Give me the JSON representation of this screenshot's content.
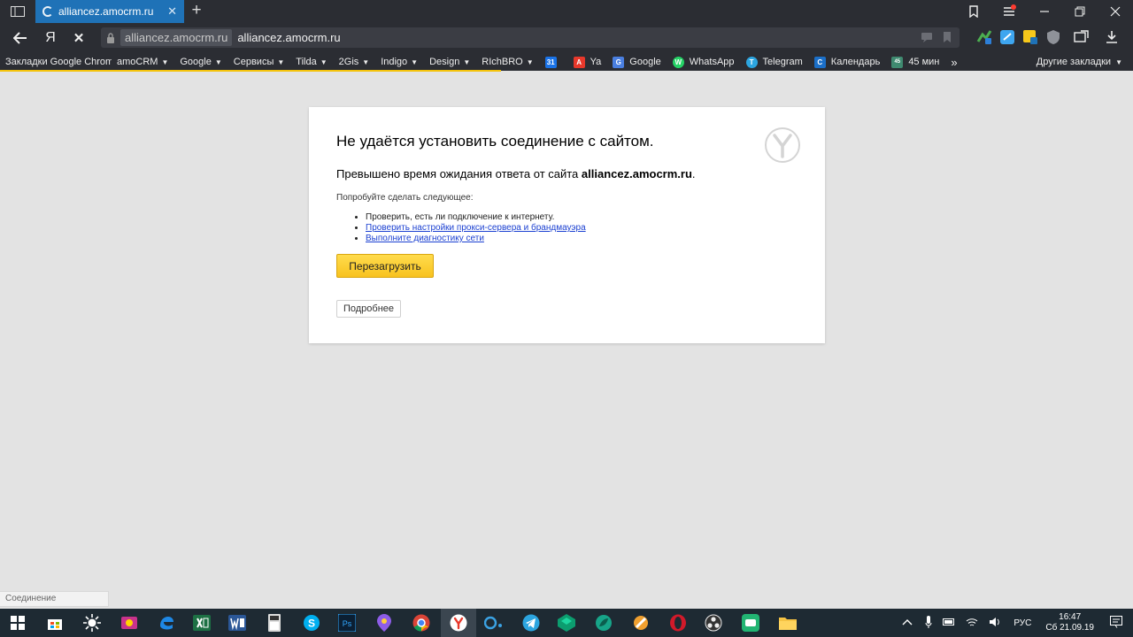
{
  "browser": {
    "tab": {
      "title": "alliancez.amocrm.ru",
      "close": "✕"
    },
    "new_tab": "+",
    "address": {
      "domain": "alliancez.amocrm.ru",
      "url": "alliancez.amocrm.ru"
    },
    "nav": {
      "yandex_logo": "Я",
      "stop": "✕"
    }
  },
  "bookmarks": {
    "folders": [
      {
        "label": "Закладки Google Chrome"
      },
      {
        "label": "amoCRM"
      },
      {
        "label": "Google"
      },
      {
        "label": "Сервисы"
      },
      {
        "label": "Tilda"
      },
      {
        "label": "2Gis"
      },
      {
        "label": "Indigo"
      },
      {
        "label": "Design"
      },
      {
        "label": "RIchBRO"
      }
    ],
    "links": [
      {
        "label": "",
        "icon": "calendar-31-icon",
        "badge": "31",
        "color": "#1a73e8"
      },
      {
        "label": "Ya",
        "icon": "yandex-ya-icon",
        "badge": "A",
        "color": "#e8382b"
      },
      {
        "label": "Google",
        "icon": "google-translate-icon",
        "badge": "G",
        "color": "#4a7fe0"
      },
      {
        "label": "WhatsApp",
        "icon": "whatsapp-icon",
        "badge": "W",
        "color": "#25d366"
      },
      {
        "label": "Telegram",
        "icon": "telegram-icon",
        "badge": "T",
        "color": "#2ca5e0"
      },
      {
        "label": "Календарь",
        "icon": "outlook-calendar-icon",
        "badge": "C",
        "color": "#1b6fc8"
      },
      {
        "label": "45 мин",
        "icon": "timer-45-icon",
        "badge": "45",
        "color": "#3f8a70"
      }
    ],
    "overflow": "»",
    "other": "Другие закладки"
  },
  "error": {
    "title": "Не удаётся установить соединение с сайтом.",
    "message_prefix": "Превышено время ожидания ответа от сайта ",
    "message_domain": "alliancez.amocrm.ru",
    "message_suffix": ".",
    "try_label": "Попробуйте сделать следующее:",
    "suggestions": [
      {
        "text": "Проверить, есть ли подключение к интернету.",
        "link": false
      },
      {
        "text": "Проверить настройки прокси-сервера и брандмауэра",
        "link": true
      },
      {
        "text": "Выполните диагностику сети",
        "link": true
      }
    ],
    "reload_button": "Перезагрузить",
    "details_button": "Подробнее"
  },
  "status_bar": {
    "text": "Соединение"
  },
  "taskbar": {
    "language": "РУС",
    "time": "16:47",
    "date": "Сб 21.09.19"
  },
  "colors": {
    "chrome_dark": "#2b2d33",
    "tab_active": "#1f72b7",
    "progress": "#f4c30b",
    "page_bg": "#e3e3e3",
    "link": "#1a3fd1",
    "reload_yellow": "#f8c21f"
  }
}
